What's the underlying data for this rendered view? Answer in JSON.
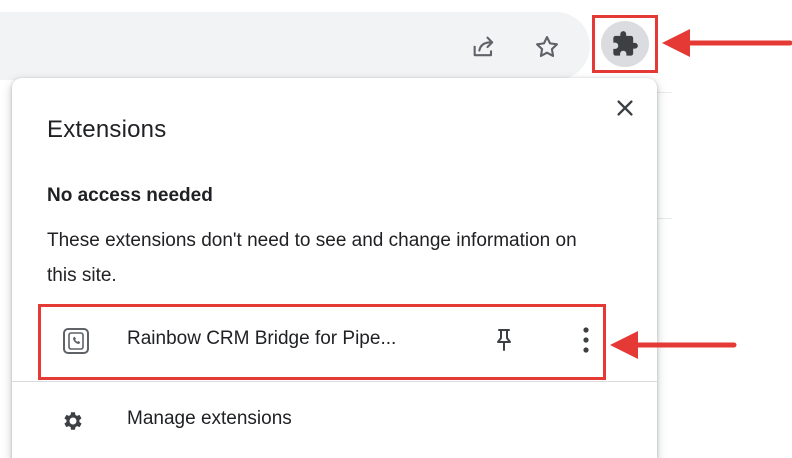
{
  "toolbar": {
    "share_icon": "share-icon",
    "bookmark_icon": "star-icon",
    "extensions_icon": "puzzle-icon"
  },
  "popup": {
    "title": "Extensions",
    "close_icon": "close-icon",
    "section_heading": "No access needed",
    "section_description": "These extensions don't need to see and change information on this site."
  },
  "extensions": [
    {
      "name": "Rainbow CRM Bridge for Pipe...",
      "icon": "rainbow-crm-icon",
      "pin_icon": "pin-icon",
      "more_icon": "more-vert-icon"
    }
  ],
  "footer": {
    "manage_label": "Manage extensions",
    "manage_icon": "gear-icon"
  },
  "colors": {
    "highlight": "#e53935",
    "toolbar_bg": "#f1f3f4",
    "icon_button_bg": "#dadce0",
    "text": "#202124",
    "icon": "#5f6368"
  }
}
